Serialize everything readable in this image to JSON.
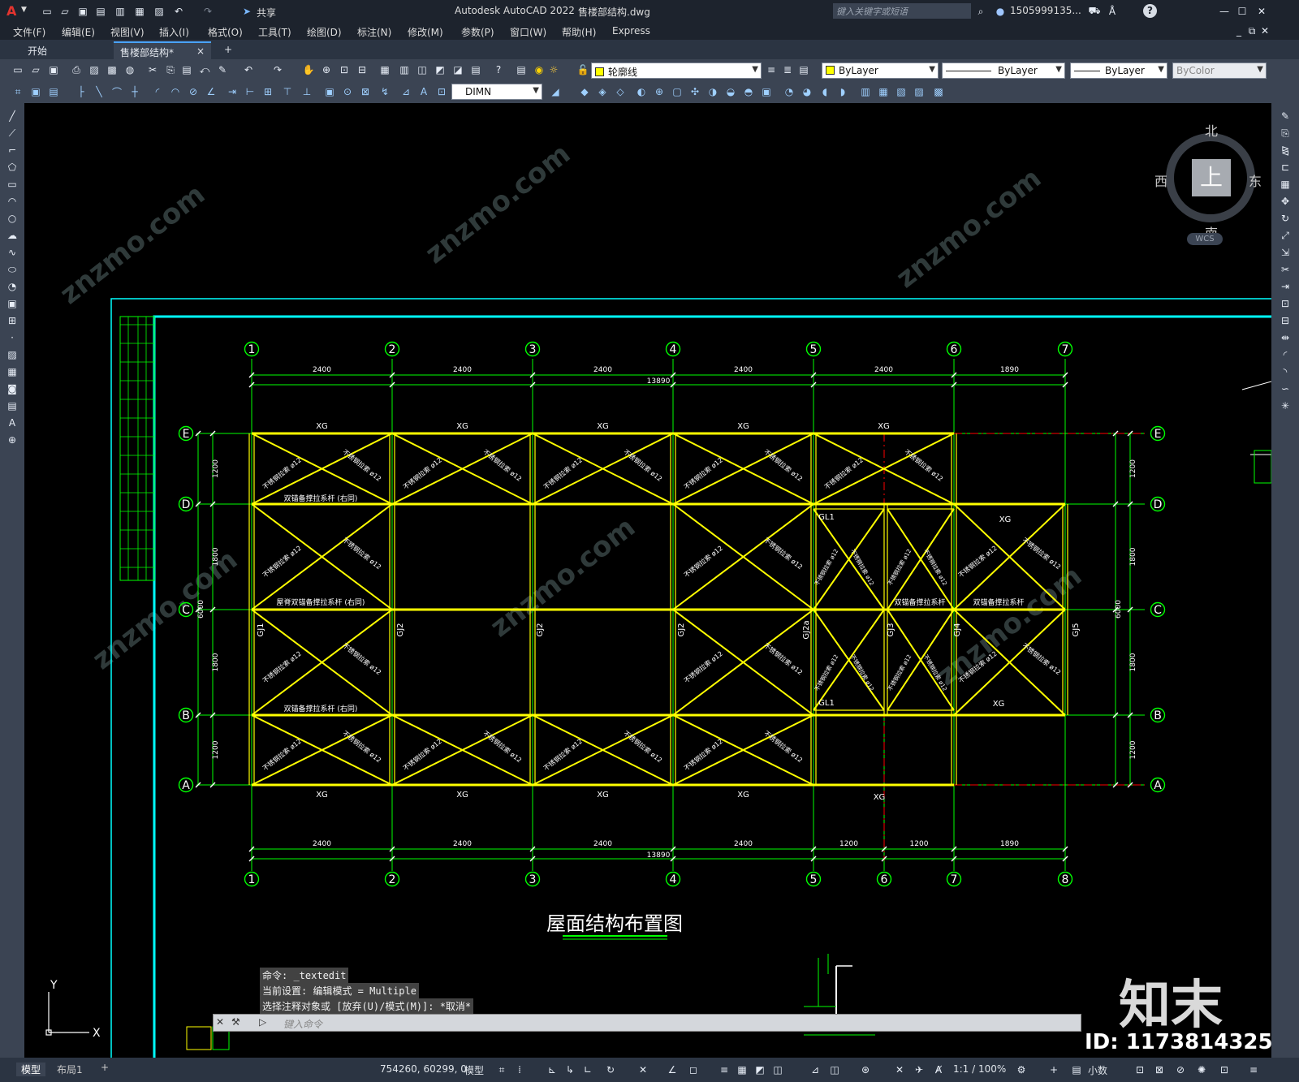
{
  "title_bar": {
    "app_logo": "A",
    "share_label": "共享",
    "window_title": "Autodesk AutoCAD 2022",
    "file_name": "售楼部结构.dwg",
    "search_placeholder": "键入关键字或短语",
    "user": "1505999135...",
    "help": "?"
  },
  "menu": [
    "文件(F)",
    "编辑(E)",
    "视图(V)",
    "插入(I)",
    "格式(O)",
    "工具(T)",
    "绘图(D)",
    "标注(N)",
    "修改(M)",
    "参数(P)",
    "窗口(W)",
    "帮助(H)",
    "Express"
  ],
  "tabs": {
    "start": "开始",
    "active": "售楼部结构*",
    "close": "×",
    "add": "+"
  },
  "toolbar": {
    "layer": "轮廓线",
    "color": "ByLayer",
    "linetype": "ByLayer",
    "lineweight": "ByLayer",
    "plotstyle": "ByColor",
    "dimstyle": "DIMN"
  },
  "viewcube": {
    "north": "北",
    "south": "南",
    "east": "东",
    "west": "西",
    "top": "上",
    "wcs": "WCS"
  },
  "drawing": {
    "title": "屋面结构布置图",
    "top_axes": [
      "1",
      "2",
      "3",
      "4",
      "5",
      "6",
      "7"
    ],
    "bottom_axes": [
      "1",
      "2",
      "3",
      "4",
      "5",
      "6",
      "7",
      "8"
    ],
    "row_axes": [
      "E",
      "D",
      "C",
      "B",
      "A"
    ],
    "top_dims": [
      "2400",
      "2400",
      "2400",
      "2400",
      "2400",
      "1890"
    ],
    "top_total": "13890",
    "bottom_dims": [
      "2400",
      "2400",
      "2400",
      "2400",
      "1200",
      "1200",
      "1890"
    ],
    "bottom_total": "13890",
    "left_dims": [
      "1200",
      "1800",
      "1800",
      "1200"
    ],
    "left_total": "6000",
    "right_dims": [
      "1200",
      "1800",
      "1800",
      "1200"
    ],
    "right_total": "6000",
    "xg": "XG",
    "gl1": "GL1",
    "gj_labels": [
      "GJ1",
      "GJ2",
      "GJ2",
      "GJ2",
      "GJ2a",
      "GJ3",
      "GJ4",
      "GJ5"
    ],
    "bar_label": "不锈钢拉索 ø12",
    "system_label": "双锚备撑拉系杆 (右同)",
    "system_label2": "双锚备撑拉系杆",
    "system_label3": "屋脊双锚备撑拉系杆 (右同)"
  },
  "command": {
    "line1": "命令: _textedit",
    "line2": "当前设置: 编辑模式 = Multiple",
    "line3": "选择注释对象或 [放弃(U)/模式(M)]: *取消*",
    "placeholder": "键入命令"
  },
  "status": {
    "model_tab": "模型",
    "layout_tab": "布局1",
    "add": "+",
    "coords": "754260, 60299, 0",
    "space": "模型",
    "scale": "1:1 / 100%",
    "units": "小数"
  },
  "watermark": {
    "brand": "知末",
    "id": "ID: 1173814325",
    "site": "znzmo.com"
  }
}
